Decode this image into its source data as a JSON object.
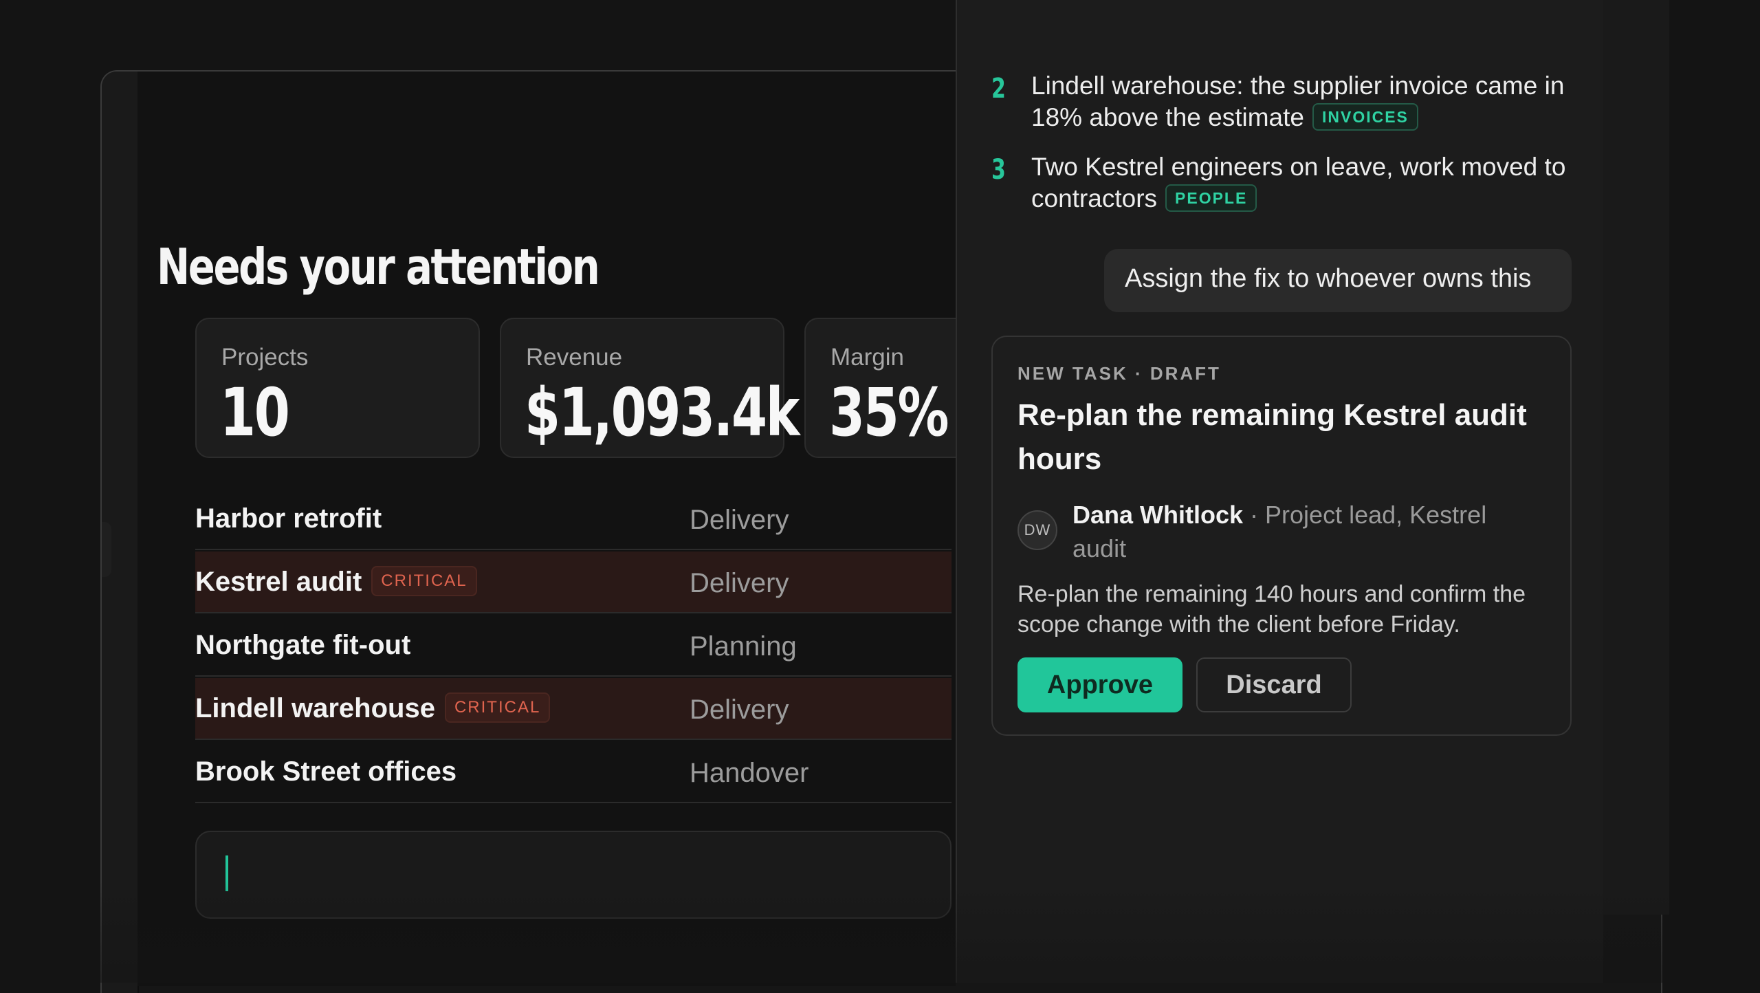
{
  "main": {
    "heading": "Needs your attention",
    "kpis": [
      {
        "label": "Projects",
        "value": "10"
      },
      {
        "label": "Revenue",
        "value": "$1,093.4k"
      },
      {
        "label": "Margin",
        "value": "35%"
      }
    ],
    "projects": [
      {
        "name": "Harbor retrofit",
        "stage": "Delivery",
        "badge": ""
      },
      {
        "name": "Kestrel audit",
        "stage": "Delivery",
        "badge": "CRITICAL"
      },
      {
        "name": "Northgate fit-out",
        "stage": "Planning",
        "badge": ""
      },
      {
        "name": "Lindell warehouse",
        "stage": "Delivery",
        "badge": "CRITICAL"
      },
      {
        "name": "Brook Street offices",
        "stage": "Handover",
        "badge": ""
      }
    ],
    "composer_value": ""
  },
  "assistant": {
    "issues": [
      {
        "number": "2",
        "text": "Lindell warehouse: the supplier invoice came in 18% above the estimate",
        "tag": "INVOICES"
      },
      {
        "number": "3",
        "text": "Two Kestrel engineers on leave, work moved to contractors",
        "tag": "PEOPLE"
      }
    ],
    "user_message": "Assign the fix to whoever owns this",
    "task_card": {
      "kicker": "NEW TASK · DRAFT",
      "title": "Re-plan the remaining Kestrel audit hours",
      "assignee_initials": "DW",
      "assignee_name": "Dana Whitlock",
      "assignee_role": "· Project lead, Kestrel audit",
      "description": "Re-plan the remaining 140 hours and confirm the scope change with the client before Friday.",
      "approve_label": "Approve",
      "discard_label": "Discard"
    }
  },
  "colors": {
    "accent": "#21c69a",
    "critical": "#e0644f",
    "critical_row_bg": "#2a1917"
  }
}
